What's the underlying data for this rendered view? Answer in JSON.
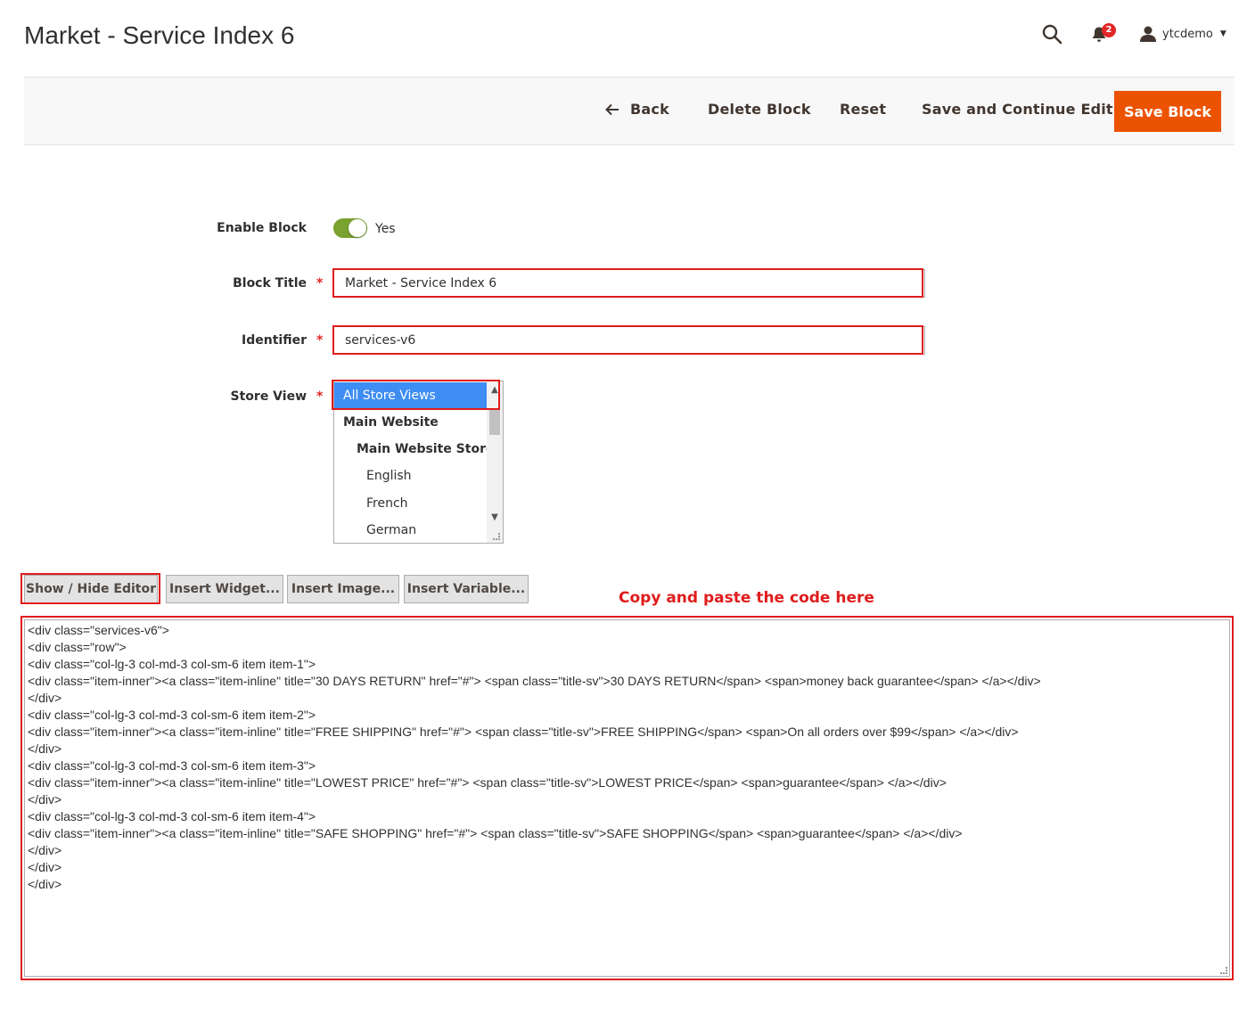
{
  "header": {
    "page_title": "Market - Service Index 6",
    "notification_count": "2",
    "username": "ytcdemo"
  },
  "actions": {
    "back": "Back",
    "delete": "Delete Block",
    "reset": "Reset",
    "save_continue": "Save and Continue Edit",
    "save": "Save Block"
  },
  "form": {
    "enable_block": {
      "label": "Enable Block",
      "value": "Yes"
    },
    "block_title": {
      "label": "Block Title",
      "value": "Market - Service Index 6"
    },
    "identifier": {
      "label": "Identifier",
      "value": "services-v6"
    },
    "store_view": {
      "label": "Store View",
      "options": [
        {
          "label": "All Store Views",
          "level": 0,
          "selected": true
        },
        {
          "label": "Main Website",
          "level": 1
        },
        {
          "label": "Main Website Store",
          "level": 2
        },
        {
          "label": "English",
          "level": 3
        },
        {
          "label": "French",
          "level": 3
        },
        {
          "label": "German",
          "level": 3
        }
      ]
    },
    "required_mark": "*"
  },
  "editor": {
    "show_hide": "Show / Hide Editor",
    "insert_widget": "Insert Widget...",
    "insert_image": "Insert Image...",
    "insert_variable": "Insert Variable...",
    "annotation": "Copy and paste the code here",
    "code_lines": [
      "<div class=\"services-v6\">",
      "<div class=\"row\">",
      "<div class=\"col-lg-3 col-md-3 col-sm-6 item item-1\">",
      "<div class=\"item-inner\"><a class=\"item-inline\" title=\"30 DAYS RETURN\" href=\"#\"> <span class=\"title-sv\">30 DAYS RETURN</span> <span>money back guarantee</span> </a></div>",
      "</div>",
      "<div class=\"col-lg-3 col-md-3 col-sm-6 item item-2\">",
      "<div class=\"item-inner\"><a class=\"item-inline\" title=\"FREE SHIPPING\" href=\"#\"> <span class=\"title-sv\">FREE SHIPPING</span> <span>On all orders over $99</span> </a></div>",
      "</div>",
      "<div class=\"col-lg-3 col-md-3 col-sm-6 item item-3\">",
      "<div class=\"item-inner\"><a class=\"item-inline\" title=\"LOWEST PRICE\" href=\"#\"> <span class=\"title-sv\">LOWEST PRICE</span> <span>guarantee</span> </a></div>",
      "</div>",
      "<div class=\"col-lg-3 col-md-3 col-sm-6 item item-4\">",
      "<div class=\"item-inner\"><a class=\"item-inline\" title=\"SAFE SHOPPING\" href=\"#\"> <span class=\"title-sv\">SAFE SHOPPING</span> <span>guarantee</span> </a></div>",
      "</div>",
      "</div>",
      "</div>"
    ]
  },
  "colors": {
    "accent": "#eb5202",
    "toggle_on": "#79a22e",
    "selected_option": "#3e8df2",
    "annotation_red": "#e01c1c",
    "badge": "#e22626"
  }
}
